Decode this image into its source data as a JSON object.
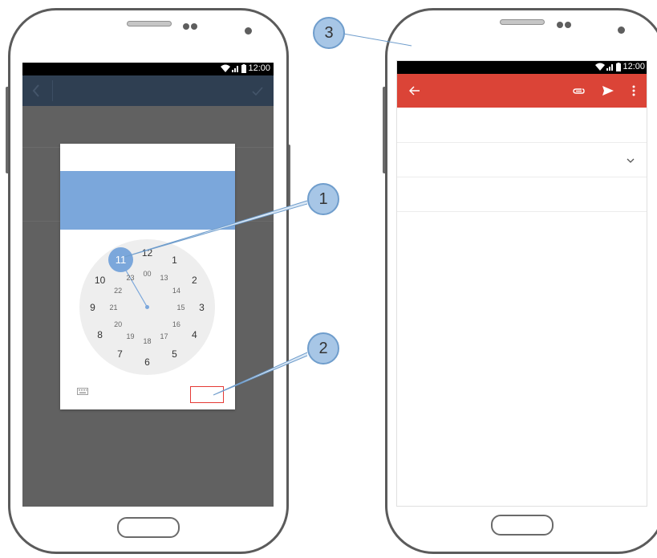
{
  "status_bar": {
    "time": "12:00"
  },
  "time_picker": {
    "selected_hour": "11",
    "outer_hours": [
      "12",
      "1",
      "2",
      "3",
      "4",
      "5",
      "6",
      "7",
      "8",
      "9",
      "10"
    ],
    "inner_hours": [
      "00",
      "13",
      "14",
      "15",
      "16",
      "17",
      "18",
      "19",
      "20",
      "21",
      "22",
      "23"
    ]
  },
  "callouts": [
    "1",
    "2",
    "3"
  ],
  "colors": {
    "accent_blue": "#7ba7db",
    "compose_red": "#db4437",
    "highlight_red": "#e53935"
  },
  "icons": [
    "back-chevron-icon",
    "check-icon",
    "keyboard-icon",
    "wifi-icon",
    "signal-icon",
    "battery-icon",
    "back-arrow-icon",
    "attach-icon",
    "send-icon",
    "more-vert-icon",
    "chevron-down-icon"
  ]
}
